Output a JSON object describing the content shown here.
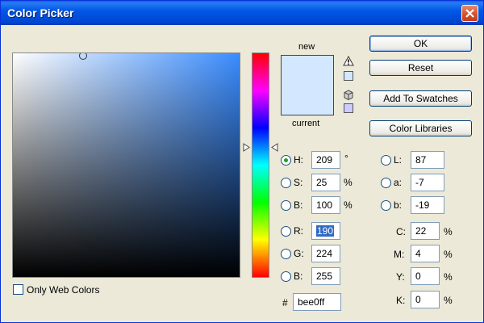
{
  "window": {
    "title": "Color Picker"
  },
  "preview": {
    "new_label": "new",
    "current_label": "current",
    "new_color": "#d3e8ff",
    "current_color": "#d3e8ff"
  },
  "buttons": {
    "ok": "OK",
    "reset": "Reset",
    "add_to_swatches": "Add To Swatches",
    "color_libraries": "Color Libraries"
  },
  "hsb": {
    "h": {
      "label": "H:",
      "value": "209",
      "unit": "°"
    },
    "s": {
      "label": "S:",
      "value": "25",
      "unit": "%"
    },
    "b": {
      "label": "B:",
      "value": "100",
      "unit": "%"
    }
  },
  "rgb": {
    "r": {
      "label": "R:",
      "value": "190"
    },
    "g": {
      "label": "G:",
      "value": "224"
    },
    "b": {
      "label": "B:",
      "value": "255"
    }
  },
  "lab": {
    "l": {
      "label": "L:",
      "value": "87"
    },
    "a": {
      "label": "a:",
      "value": "-7"
    },
    "b": {
      "label": "b:",
      "value": "-19"
    }
  },
  "cmyk": {
    "c": {
      "label": "C:",
      "value": "22",
      "unit": "%"
    },
    "m": {
      "label": "M:",
      "value": "4",
      "unit": "%"
    },
    "y": {
      "label": "Y:",
      "value": "0",
      "unit": "%"
    },
    "k": {
      "label": "K:",
      "value": "0",
      "unit": "%"
    }
  },
  "hex": {
    "label": "#",
    "value": "bee0ff"
  },
  "web_colors": {
    "label": "Only Web Colors"
  },
  "colors": {
    "field_hue": "#3a8cff",
    "gamut_warning_swatch": "#d3e8ff",
    "web_safe_swatch": "#ccccff",
    "titlebar": "#0058e6"
  },
  "icons": {
    "gamut_warning": "warning-triangle-icon",
    "web_safe": "cube-icon",
    "close": "close-x-icon"
  }
}
